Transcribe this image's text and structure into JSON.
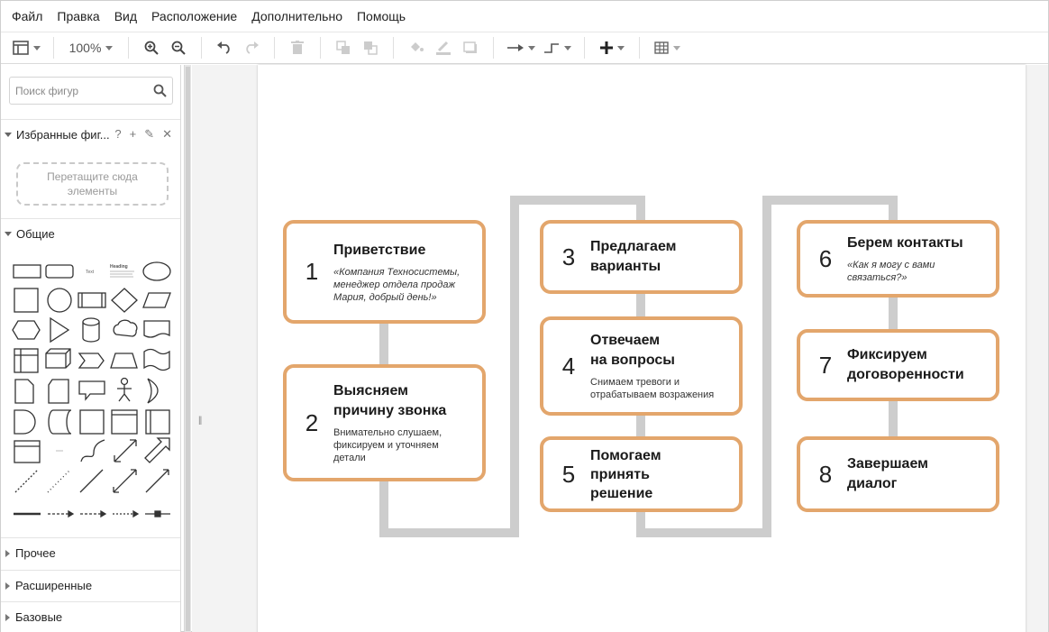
{
  "menu": [
    "Файл",
    "Правка",
    "Вид",
    "Расположение",
    "Дополнительно",
    "Помощь"
  ],
  "toolbar": {
    "zoom": "100%"
  },
  "sidebar": {
    "search_placeholder": "Поиск фигур",
    "favorites_title": "Избранные фиг...",
    "favorites_actions": [
      "?",
      "+",
      "✎",
      "✕"
    ],
    "dropzone_text": "Перетащите сюда элементы",
    "general_title": "Общие",
    "sections": [
      "Прочее",
      "Расширенные",
      "Базовые"
    ],
    "mini_text_label": "Text",
    "mini_heading_label": "Heading"
  },
  "diagram": {
    "steps": [
      {
        "num": "1",
        "title": "Приветствие",
        "desc": "«Компания Техносистемы,\nменеджер отдела продаж\nМария, добрый день!»",
        "italic": true
      },
      {
        "num": "2",
        "title": "Выясняем\nпричину звонка",
        "desc": "Внимательно слушаем,\nфиксируем и уточняем\nдетали",
        "italic": false
      },
      {
        "num": "3",
        "title": "Предлагаем\nварианты",
        "desc": "",
        "italic": false
      },
      {
        "num": "4",
        "title": "Отвечаем\nна вопросы",
        "desc": "Снимаем тревоги и\nотрабатываем возражения",
        "italic": false
      },
      {
        "num": "5",
        "title": "Помогаем\nпринять\nрешение",
        "desc": "",
        "italic": false
      },
      {
        "num": "6",
        "title": "Берем контакты",
        "desc": "«Как я могу с вами\nсвязаться?»",
        "italic": true
      },
      {
        "num": "7",
        "title": "Фиксируем\nдоговоренности",
        "desc": "",
        "italic": false
      },
      {
        "num": "8",
        "title": "Завершаем\nдиалог",
        "desc": "",
        "italic": false
      }
    ]
  },
  "colors": {
    "step_border": "#e3a66c",
    "connector": "#cdcdcd",
    "canvas": "#f3f3f3"
  }
}
